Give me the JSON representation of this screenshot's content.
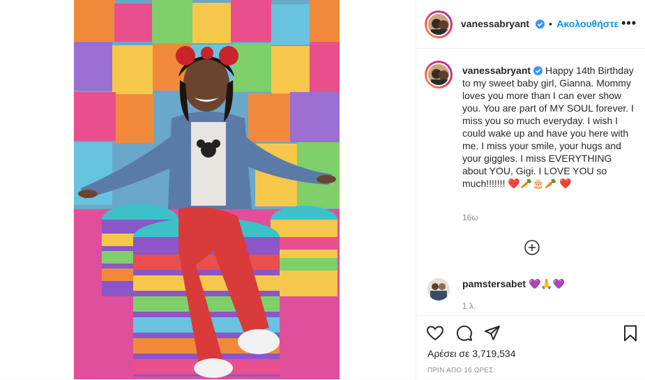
{
  "post": {
    "author": "vanessabryant",
    "follow_label": "Ακολουθήστε",
    "more_icon": "more-options-icon",
    "caption_text": "Happy 14th Birthday to my sweet baby girl, Gianna. Mommy loves you more than I can ever show you. You are part of MY SOUL forever. I miss you so much everyday. I wish I could wake up and have you here with me. I miss your smile, your hugs and your giggles. I miss EVERYTHING about YOU, Gigi. I LOVE YOU so much!!!!!!! ❤️🥕🎂🥕 ❤️",
    "caption_emojis": "❤ 🥕 🎂 🥕 ❤",
    "caption_time": "16ω",
    "load_more_icon": "plus-circle-icon",
    "likes_label": "Αρέσει σε",
    "likes_count": "3,719,534",
    "posted_time": "ΠΡΙΝ ΑΠΟ 16 ΩΡΕΣ"
  },
  "comment": {
    "author": "pamstersabet",
    "text": "💜🙏💜",
    "time": "1 λ."
  },
  "colors": {
    "accent": "#0095f6",
    "verified": "#3897f0",
    "text": "#262626",
    "muted": "#8e8e8e"
  }
}
